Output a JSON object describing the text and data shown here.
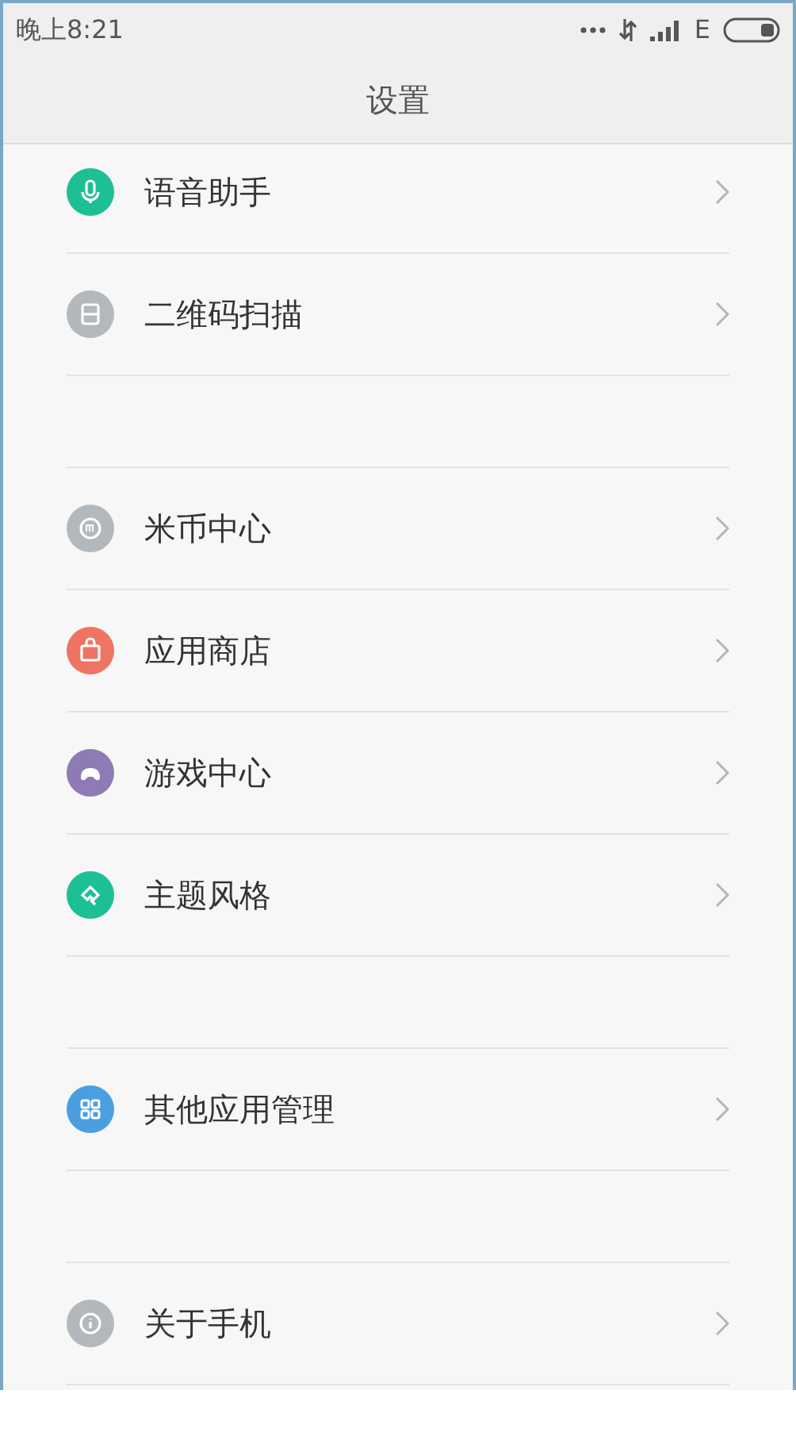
{
  "status_bar": {
    "time": "晚上8:21",
    "network": "E"
  },
  "title": "设置",
  "groups": [
    {
      "items": [
        {
          "label": "语音助手",
          "kind": "mic",
          "color": "#1dbf94"
        },
        {
          "label": "二维码扫描",
          "kind": "scan",
          "color": "#b3b8bd"
        }
      ]
    },
    {
      "items": [
        {
          "label": "米币中心",
          "kind": "coin",
          "color": "#b3b8bd"
        },
        {
          "label": "应用商店",
          "kind": "bag",
          "color": "#ef7463"
        },
        {
          "label": "游戏中心",
          "kind": "gamepad",
          "color": "#8e7bb6"
        },
        {
          "label": "主题风格",
          "kind": "brush",
          "color": "#1cbf96"
        }
      ]
    },
    {
      "items": [
        {
          "label": "其他应用管理",
          "kind": "grid",
          "color": "#4a9fe1"
        }
      ]
    },
    {
      "items": [
        {
          "label": "关于手机",
          "kind": "info",
          "color": "#b3b8bd"
        }
      ]
    }
  ]
}
